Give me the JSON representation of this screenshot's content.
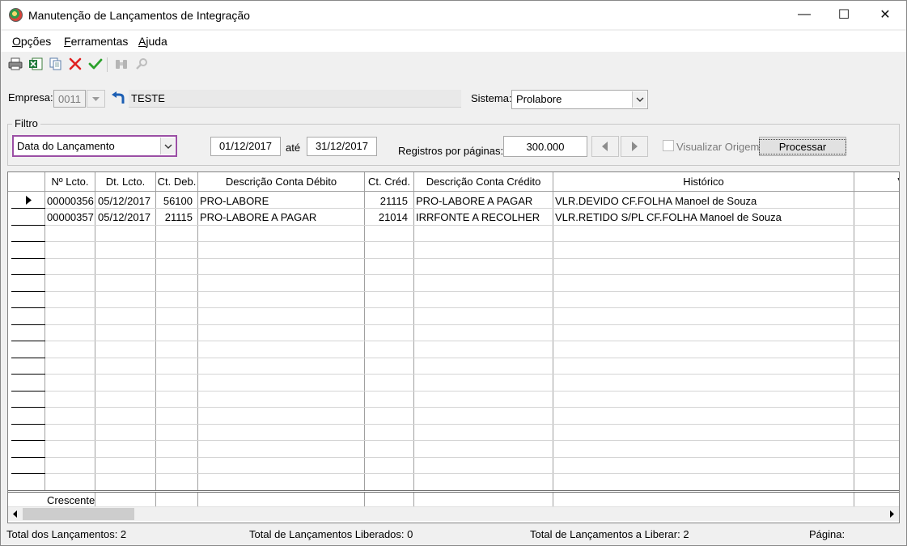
{
  "window": {
    "title": "Manutenção de Lançamentos de Integração",
    "controls": {
      "minimize": "—",
      "maximize": "☐",
      "close": "✕"
    }
  },
  "menu": {
    "items": [
      {
        "label_ul": "O",
        "label_rest": "pções"
      },
      {
        "label_ul": "F",
        "label_rest": "erramentas"
      },
      {
        "label_ul": "A",
        "label_rest": "juda"
      }
    ]
  },
  "toolbar": {
    "icons": [
      "print-icon",
      "excel-export-icon",
      "copy-icon",
      "delete-icon",
      "confirm-icon",
      "binoculars-icon",
      "search-icon"
    ]
  },
  "empresa": {
    "label": "Empresa:",
    "code": "0011",
    "name": "TESTE"
  },
  "sistema": {
    "label": "Sistema:",
    "value": "Prolabore"
  },
  "filtro": {
    "legend": "Filtro",
    "field_value": "Data do Lançamento",
    "date_from": "01/12/2017",
    "ate_label": "até",
    "date_to": "31/12/2017",
    "registros_label": "Registros por páginas:",
    "registros_value": "300.000",
    "visualizar_label": "Visualizar Origem",
    "visualizar_checked": false,
    "processar_label": "Processar"
  },
  "grid": {
    "columns": [
      "Nº Lcto.",
      "Dt. Lcto.",
      "Ct. Deb.",
      "Descrição Conta Débito",
      "Ct. Créd.",
      "Descrição Conta Crédito",
      "Histórico",
      "V"
    ],
    "rows": [
      {
        "lcto": "00000356",
        "dt": "05/12/2017",
        "deb": "56100",
        "desc_deb": "PRO-LABORE",
        "cred": "21115",
        "desc_cred": "PRO-LABORE A PAGAR",
        "hist": "VLR.DEVIDO CF.FOLHA  Manoel de Souza"
      },
      {
        "lcto": "00000357",
        "dt": "05/12/2017",
        "deb": "21115",
        "desc_deb": "PRO-LABORE A PAGAR",
        "cred": "21014",
        "desc_cred": "IRRFONTE A RECOLHER",
        "hist": "VLR.RETIDO S/PL CF.FOLHA  Manoel de Souza"
      }
    ],
    "footer_sort": "Crescente"
  },
  "status": {
    "total": "Total dos Lançamentos: 2",
    "liberados": "Total de Lançamentos Liberados: 0",
    "a_liberar": "Total de Lançamentos a Liberar: 2",
    "pagina": "Página:"
  },
  "colors": {
    "highlight_border": "#9b4fa5",
    "delete_red": "#e02020",
    "confirm_green": "#2aa12a"
  }
}
